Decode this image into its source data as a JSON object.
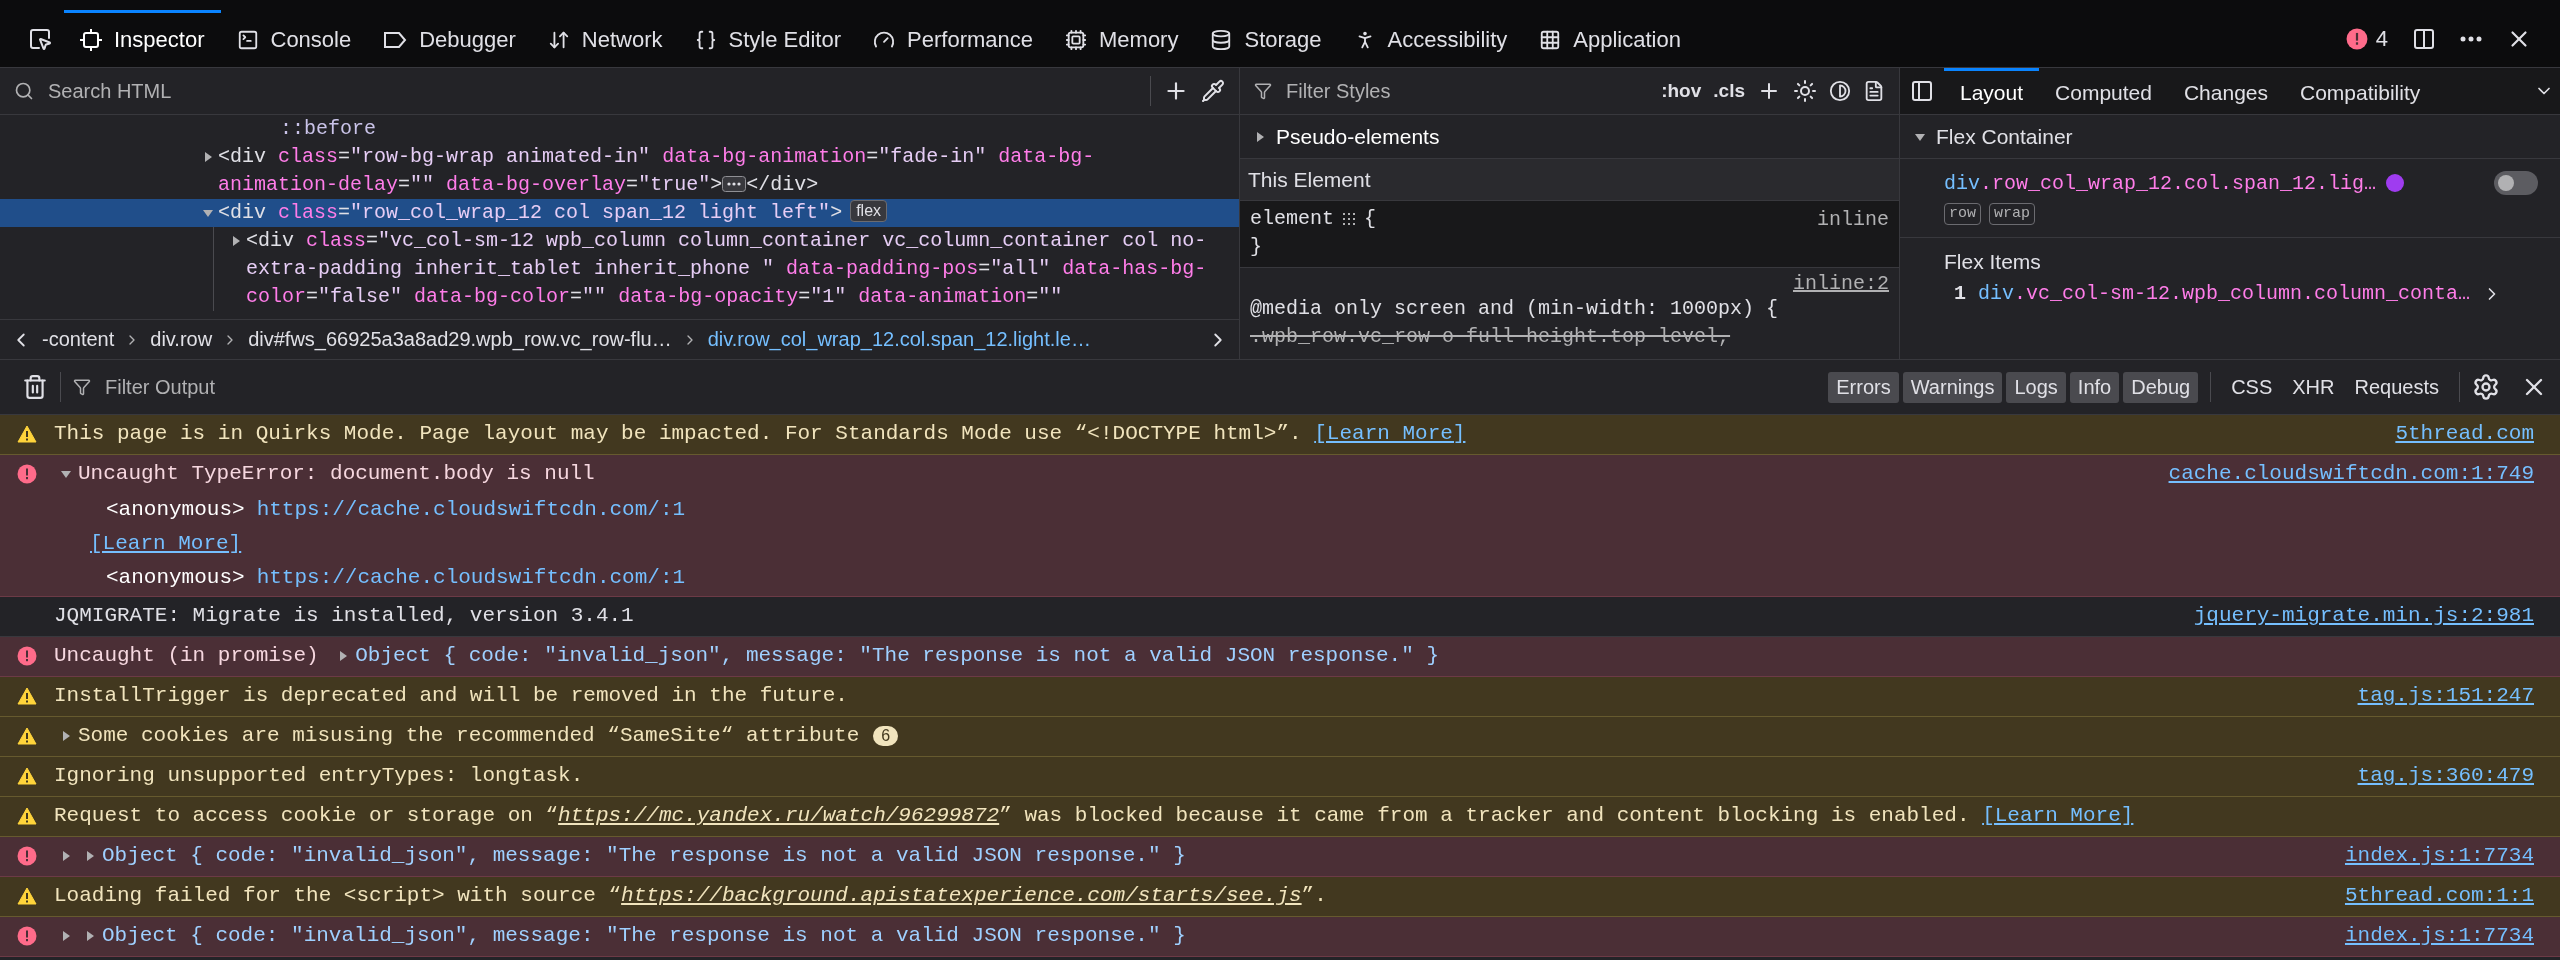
{
  "toolbar": {
    "tabs": [
      {
        "kind": "inspector",
        "label": "Inspector",
        "selected": true
      },
      {
        "kind": "console",
        "label": "Console",
        "selected": false
      },
      {
        "kind": "debugger",
        "label": "Debugger",
        "selected": false
      },
      {
        "kind": "network",
        "label": "Network",
        "selected": false
      },
      {
        "kind": "style",
        "label": "Style Editor",
        "selected": false
      },
      {
        "kind": "performance",
        "label": "Performance",
        "selected": false
      },
      {
        "kind": "memory",
        "label": "Memory",
        "selected": false
      },
      {
        "kind": "storage",
        "label": "Storage",
        "selected": false
      },
      {
        "kind": "accessibility",
        "label": "Accessibility",
        "selected": false
      },
      {
        "kind": "application",
        "label": "Application",
        "selected": false
      }
    ],
    "error_count": "4"
  },
  "inspector": {
    "markup": {
      "search_placeholder": "Search HTML",
      "nodes": [
        {
          "kind": "pseudo",
          "markup": "::before",
          "selected": false
        },
        {
          "kind": "element",
          "markup": "<div class=\"row-bg-wrap animated-in\" data-bg-animation=\"fade-in\" data-bg-animation-delay=\"\" data-bg-overlay=\"true\">",
          "expanded": false,
          "collapsed_content": true,
          "closing": "</div>",
          "selected": false
        },
        {
          "kind": "element",
          "markup": "<div class=\"row_col_wrap_12 col span_12 light left\">",
          "expanded": true,
          "badge": "flex",
          "selected": true,
          "children": [
            {
              "kind": "element",
              "markup": "<div class=\"vc_col-sm-12 wpb_column column_container vc_column_container col no-extra-padding inherit_tablet inherit_phone \" data-padding-pos=\"all\" data-has-bg-color=\"false\" data-bg-color=\"\" data-bg-opacity=\"1\" data-animation=\"\"",
              "expanded": false,
              "selected": false
            }
          ]
        }
      ]
    },
    "breadcrumbs": [
      {
        "label": "-content",
        "selected": false
      },
      {
        "label": "div.row",
        "selected": false
      },
      {
        "label": "div#fws_66925a3a8ad29.wpb_row.vc_row-flu…",
        "selected": false
      },
      {
        "label": "div.row_col_wrap_12.col.span_12.light.le…",
        "selected": true
      }
    ],
    "rules": {
      "filter_placeholder": "Filter Styles",
      "buttons": [
        ":hov",
        ".cls"
      ],
      "pseudo_elements": {
        "label": "Pseudo-elements",
        "expanded": false
      },
      "this_element": "This Element",
      "element_rule": {
        "selector": "element",
        "open": "{",
        "close": "}",
        "source": "inline"
      },
      "media_rule": {
        "source": "inline:2",
        "query": "@media only screen and (min-width: 1000px) {",
        "selectors": [
          {
            "text": ".wpb_row.vc_row-o-full-height.top-level,",
            "matched": false
          }
        ]
      }
    },
    "layout": {
      "tabs": [
        {
          "label": "Layout",
          "selected": true
        },
        {
          "label": "Computed",
          "selected": false
        },
        {
          "label": "Changes",
          "selected": false
        },
        {
          "label": "Compatibility",
          "selected": false
        }
      ],
      "flex_container": {
        "title": "Flex Container",
        "expanded": true,
        "selector": "div.row_col_wrap_12.col.span_12.lig…",
        "color": "#9f3cf0",
        "highlight_on": false,
        "tags": [
          "row",
          "wrap"
        ]
      },
      "flex_items": {
        "title": "Flex Items",
        "items": [
          {
            "index": "1",
            "selector": "div.vc_col-sm-12.wpb_column.column_conta…"
          }
        ]
      }
    }
  },
  "console": {
    "filter_placeholder": "Filter Output",
    "levels": [
      {
        "label": "Errors",
        "selected": true
      },
      {
        "label": "Warnings",
        "selected": true
      },
      {
        "label": "Logs",
        "selected": true
      },
      {
        "label": "Info",
        "selected": true
      },
      {
        "label": "Debug",
        "selected": true
      }
    ],
    "types": [
      {
        "label": "CSS",
        "selected": false
      },
      {
        "label": "XHR",
        "selected": false
      },
      {
        "label": "Requests",
        "selected": false
      }
    ],
    "messages": [
      {
        "kind": "warning",
        "parts": [
          {
            "kind": "text",
            "text": "This page is in Quirks Mode. Page layout may be impacted. For Standards Mode use “<!DOCTYPE html>”. "
          },
          {
            "kind": "learn_more",
            "text": "[Learn More]"
          }
        ],
        "source": "5thread.com"
      },
      {
        "kind": "error",
        "parts": [
          {
            "kind": "toggle",
            "expanded": true
          },
          {
            "kind": "text",
            "text": "Uncaught TypeError: document.body is null"
          }
        ],
        "details": [
          {
            "kind": "frame",
            "function": "<anonymous>",
            "url": "https://cache.cloudswiftcdn.com/:1"
          },
          {
            "kind": "learn_more",
            "text": "[Learn More]"
          },
          {
            "kind": "frame",
            "function": "<anonymous>",
            "url": "https://cache.cloudswiftcdn.com/:1"
          }
        ],
        "source": "cache.cloudswiftcdn.com:1:749"
      },
      {
        "kind": "log",
        "parts": [
          {
            "kind": "text",
            "text": "JQMIGRATE: Migrate is installed, version 3.4.1"
          }
        ],
        "source": "jquery-migrate.min.js:2:981"
      },
      {
        "kind": "error",
        "parts": [
          {
            "kind": "text",
            "text": "Uncaught (in promise) "
          },
          {
            "kind": "toggle",
            "expanded": false
          },
          {
            "kind": "object",
            "text": "Object { code: \"invalid_json\", message: \"The response is not a valid JSON response.\" }"
          }
        ]
      },
      {
        "kind": "warning",
        "parts": [
          {
            "kind": "text",
            "text": "InstallTrigger is deprecated and will be removed in the future."
          }
        ],
        "source": "tag.js:151:247"
      },
      {
        "kind": "warning",
        "parts": [
          {
            "kind": "toggle",
            "expanded": false
          },
          {
            "kind": "text",
            "text": "Some cookies are misusing the recommended “SameSite“ attribute"
          },
          {
            "kind": "badge",
            "text": "6"
          }
        ]
      },
      {
        "kind": "warning",
        "parts": [
          {
            "kind": "text",
            "text": "Ignoring unsupported entryTypes: longtask."
          }
        ],
        "source": "tag.js:360:479"
      },
      {
        "kind": "warning",
        "parts": [
          {
            "kind": "text",
            "text": "Request to access cookie or storage on “"
          },
          {
            "kind": "url",
            "text": "https://mc.yandex.ru/watch/96299872"
          },
          {
            "kind": "text",
            "text": "” was blocked because it came from a tracker and content blocking is enabled. "
          },
          {
            "kind": "learn_more",
            "text": "[Learn More]"
          }
        ]
      },
      {
        "kind": "error",
        "parts": [
          {
            "kind": "toggle",
            "expanded": false
          },
          {
            "kind": "toggle",
            "expanded": false
          },
          {
            "kind": "object",
            "text": "Object { code: \"invalid_json\", message: \"The response is not a valid JSON response.\" }"
          }
        ],
        "source": "index.js:1:7734"
      },
      {
        "kind": "warning",
        "parts": [
          {
            "kind": "text",
            "text": "Loading failed for the <script> with source “"
          },
          {
            "kind": "url",
            "text": "https://background.apistatexperience.com/starts/see.js"
          },
          {
            "kind": "text",
            "text": "”."
          }
        ],
        "source": "5thread.com:1:1"
      },
      {
        "kind": "error",
        "parts": [
          {
            "kind": "toggle",
            "expanded": false
          },
          {
            "kind": "toggle",
            "expanded": false
          },
          {
            "kind": "object",
            "text": "Object { code: \"invalid_json\", message: \"The response is not a valid JSON response.\" }"
          }
        ],
        "source": "index.js:1:7734"
      }
    ]
  }
}
